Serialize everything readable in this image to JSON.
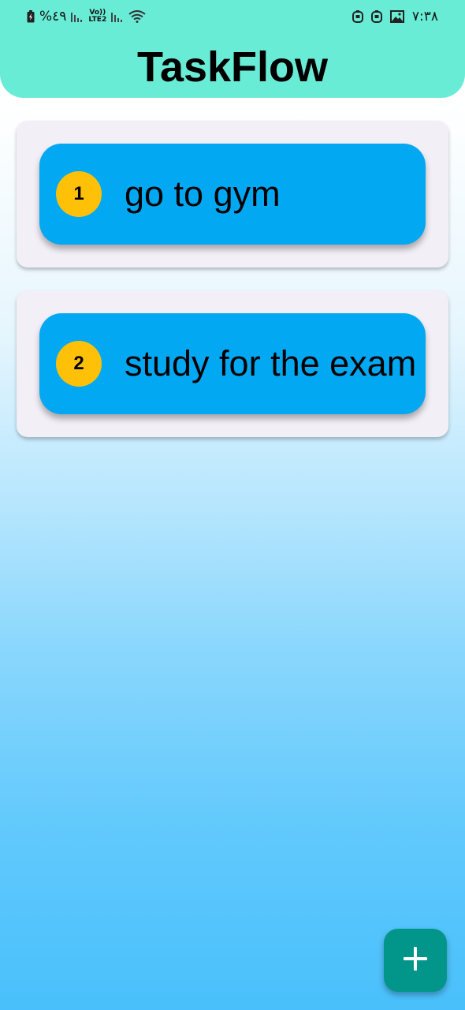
{
  "status_bar": {
    "battery_percent": "%٤٩",
    "volte_top": "Vo))",
    "volte_bottom": "LTE2",
    "time": "٧:٣٨",
    "icons": [
      "battery-charging-icon",
      "signal-icon",
      "volte-icon",
      "signal-icon",
      "wifi-icon",
      "app-notification-icon",
      "app-notification-icon",
      "image-icon"
    ]
  },
  "header": {
    "title": "TaskFlow"
  },
  "tasks": [
    {
      "number": "1",
      "text": "go to gym"
    },
    {
      "number": "2",
      "text": "study for the exam"
    }
  ],
  "fab": {
    "icon": "plus-icon"
  },
  "colors": {
    "app_bar": "#69ecd6",
    "card_bg": "#f3eff6",
    "pill": "#03a8f3",
    "badge": "#ffc107",
    "fab": "#02968a"
  }
}
